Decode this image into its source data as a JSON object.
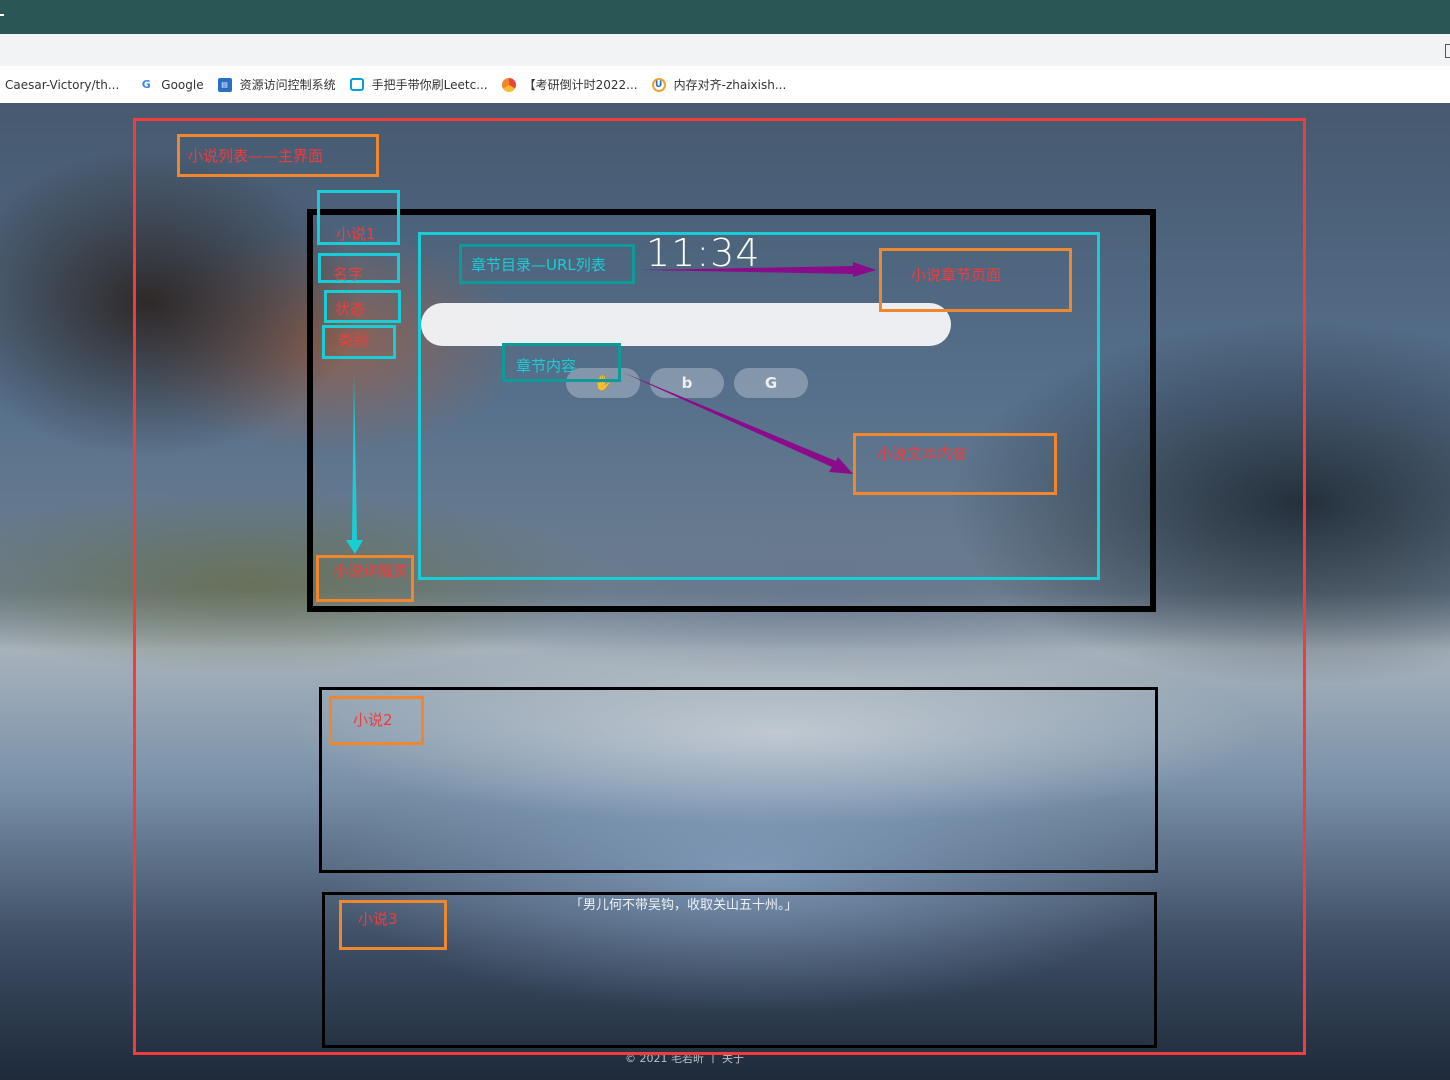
{
  "bookmarks": [
    {
      "label": "Caesar-Victory/th...",
      "icon": "none"
    },
    {
      "label": "Google",
      "icon": "google-icon"
    },
    {
      "label": "资源访问控制系统",
      "icon": "system-icon"
    },
    {
      "label": "手把手带你刷Leetc...",
      "icon": "bilibili-icon"
    },
    {
      "label": "【考研倒计时2022...",
      "icon": "chrome-like-icon"
    },
    {
      "label": "内存对齐-zhaixish...",
      "icon": "u-icon"
    }
  ],
  "newtab": {
    "clock": "11:34",
    "quote": "「男儿何不带吴钩，收取关山五十州。」",
    "footer": "© 2021 毛若昕 丨 关于",
    "engines": [
      "baidu-icon",
      "bing-icon",
      "google-icon"
    ]
  },
  "annotations": {
    "main": "小说列表——主界面",
    "novel1": "小说1",
    "name": "名字",
    "status": "状态",
    "category": "类别",
    "chapter_list": "章节目录—URL列表",
    "chapter_page": "小说章节页面",
    "chapter_content": "章节内容",
    "text_content": "小说文本内容",
    "detail_page": "小说详情页",
    "novel2": "小说2",
    "novel3": "小说3"
  },
  "colors": {
    "red": "#f03c3c",
    "orange": "#f0862e",
    "cyan": "#19cdd6",
    "teal": "#0e9a98",
    "purple": "#8b0c8b",
    "black": "#000000"
  }
}
